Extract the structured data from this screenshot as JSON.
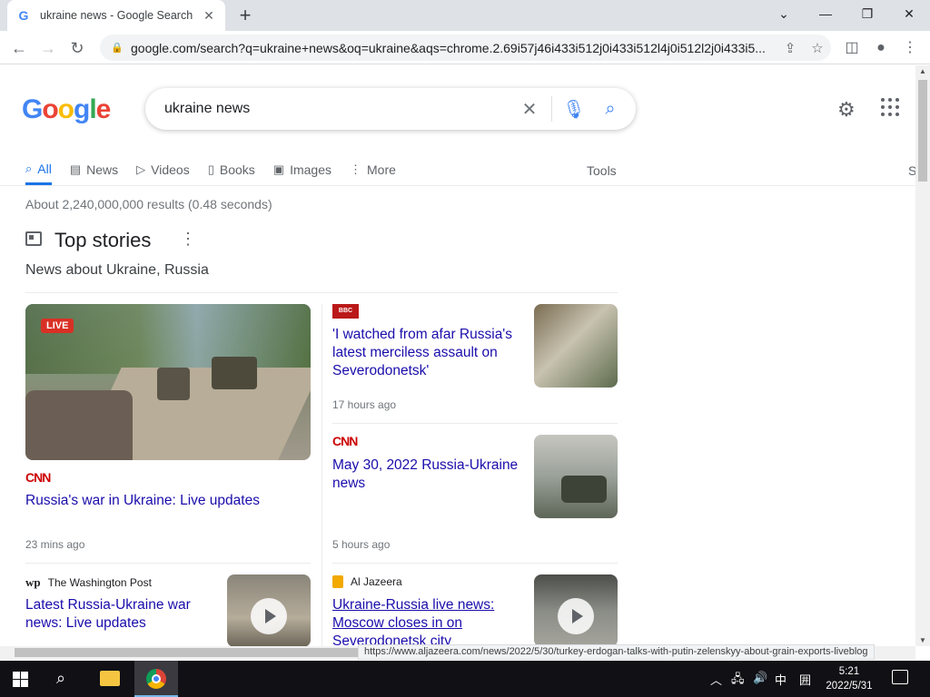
{
  "browser": {
    "tab_title": "ukraine news - Google Search",
    "favicon": "G",
    "url": "google.com/search?q=ukraine+news&oq=ukraine&aqs=chrome.2.69i57j46i433i512j0i433i512l4j0i512l2j0i433i5..."
  },
  "search": {
    "query": "ukraine news",
    "tabs": [
      {
        "label": "All",
        "icon": "search-icon"
      },
      {
        "label": "News",
        "icon": "news-icon"
      },
      {
        "label": "Videos",
        "icon": "video-icon"
      },
      {
        "label": "Books",
        "icon": "book-icon"
      },
      {
        "label": "Images",
        "icon": "image-icon"
      },
      {
        "label": "More",
        "icon": "more-vert-icon"
      }
    ],
    "tools_label": "Tools",
    "clipped_label": "S",
    "results_count": "About 2,240,000,000 results (0.48 seconds)"
  },
  "top_stories": {
    "title": "Top stories",
    "subtitle": "News about Ukraine, Russia",
    "main": {
      "badge": "LIVE",
      "source": "CNN",
      "headline": "Russia's war in Ukraine: Live updates",
      "time": "23 mins ago"
    },
    "stories": [
      {
        "source": "BBC NEWS",
        "headline": "'I watched from afar Russia's latest merciless assault on Severodonetsk'",
        "time": "17 hours ago"
      },
      {
        "source": "CNN",
        "headline": "May 30, 2022 Russia-Ukraine news",
        "time": "5 hours ago"
      },
      {
        "source": "The Washington Post",
        "source_mark": "wp",
        "headline": "Latest Russia-Ukraine war news: Live updates"
      },
      {
        "source": "Al Jazeera",
        "headline": "Ukraine-Russia live news: Moscow closes in on Severodonetsk city"
      }
    ]
  },
  "status_url": "https://www.aljazeera.com/news/2022/5/30/turkey-erdogan-talks-with-putin-zelenskyy-about-grain-exports-liveblog",
  "taskbar": {
    "ime": "中",
    "time": "5:21",
    "date": "2022/5/31"
  }
}
